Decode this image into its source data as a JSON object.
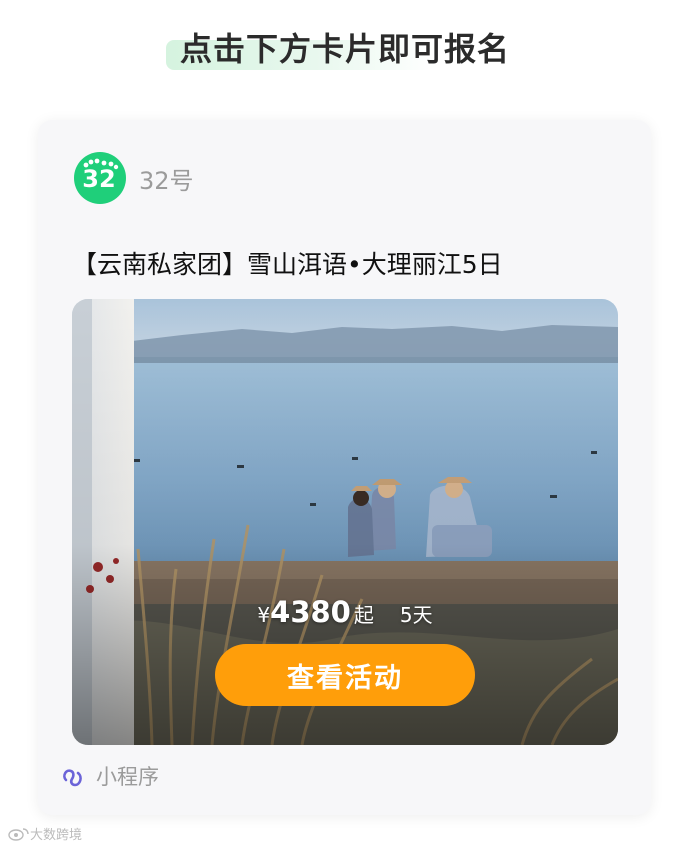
{
  "page": {
    "headline": "点击下方卡片即可报名"
  },
  "card": {
    "account": {
      "logo_icon": "green-footprints-logo",
      "logo_text": "32",
      "name": "32号"
    },
    "title": "【云南私家团】雪山洱语•大理丽江5日",
    "image": {
      "description_icon": "lake-couple-photo",
      "price_symbol": "¥",
      "price": "4380",
      "price_suffix": "起",
      "duration": "5天",
      "cta_label": "查看活动"
    },
    "footer": {
      "icon": "mini-program-icon",
      "label": "小程序"
    }
  },
  "watermark": {
    "text": "大数跨境"
  },
  "colors": {
    "accent_orange": "#ff9e0a",
    "brand_green": "#1fcf7a",
    "highlight_green": "#d5f3df",
    "mini_program_purple": "#6b63d8"
  }
}
